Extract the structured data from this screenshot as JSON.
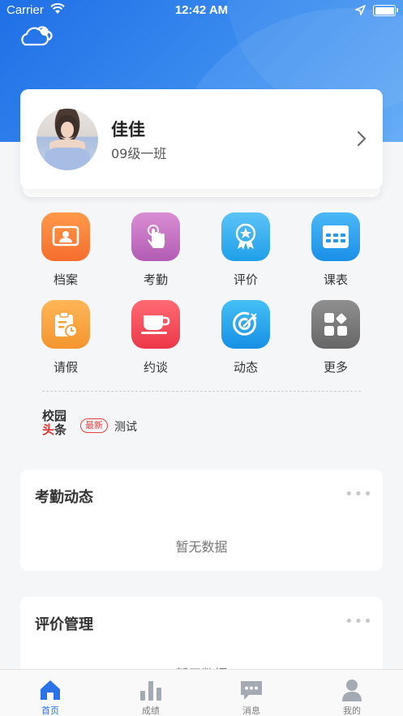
{
  "status_bar": {
    "carrier": "Carrier",
    "time": "12:42 AM"
  },
  "profile": {
    "name": "佳佳",
    "class_name": "09级一班"
  },
  "menu": [
    {
      "label": "档案",
      "icon": "profile-card-icon",
      "color_from": "#ff9a4a",
      "color_to": "#f56d2e"
    },
    {
      "label": "考勤",
      "icon": "tap-hand-icon",
      "color_from": "#d98ed2",
      "color_to": "#b25cb5"
    },
    {
      "label": "评价",
      "icon": "award-badge-icon",
      "color_from": "#5cc3f7",
      "color_to": "#1f9fe9"
    },
    {
      "label": "课表",
      "icon": "calendar-grid-icon",
      "color_from": "#4bb8f6",
      "color_to": "#1a8fe6"
    },
    {
      "label": "请假",
      "icon": "clipboard-clock-icon",
      "color_from": "#ffb657",
      "color_to": "#f3952f"
    },
    {
      "label": "约谈",
      "icon": "coffee-cup-icon",
      "color_from": "#ff6b73",
      "color_to": "#ec3749"
    },
    {
      "label": "动态",
      "icon": "target-icon",
      "color_from": "#45c0f5",
      "color_to": "#168fe4"
    },
    {
      "label": "更多",
      "icon": "apps-grid-icon",
      "color_from": "#8f8f8f",
      "color_to": "#666666"
    }
  ],
  "news": {
    "logo_line1": "校园",
    "logo_line2_a": "头",
    "logo_line2_b": "条",
    "badge": "最新",
    "title": "测试"
  },
  "sections": [
    {
      "title": "考勤动态",
      "more": "•••",
      "empty": "暂无数据"
    },
    {
      "title": "评价管理",
      "more": "•••",
      "empty": "暂无数据"
    }
  ],
  "tabs": [
    {
      "label": "首页",
      "active": true
    },
    {
      "label": "成绩",
      "active": false
    },
    {
      "label": "消息",
      "active": false
    },
    {
      "label": "我的",
      "active": false
    }
  ],
  "colors": {
    "primary": "#2a72e8",
    "header_from": "#1f6fe6",
    "header_to": "#5aa6f6",
    "tab_inactive": "#7c7c7c"
  }
}
